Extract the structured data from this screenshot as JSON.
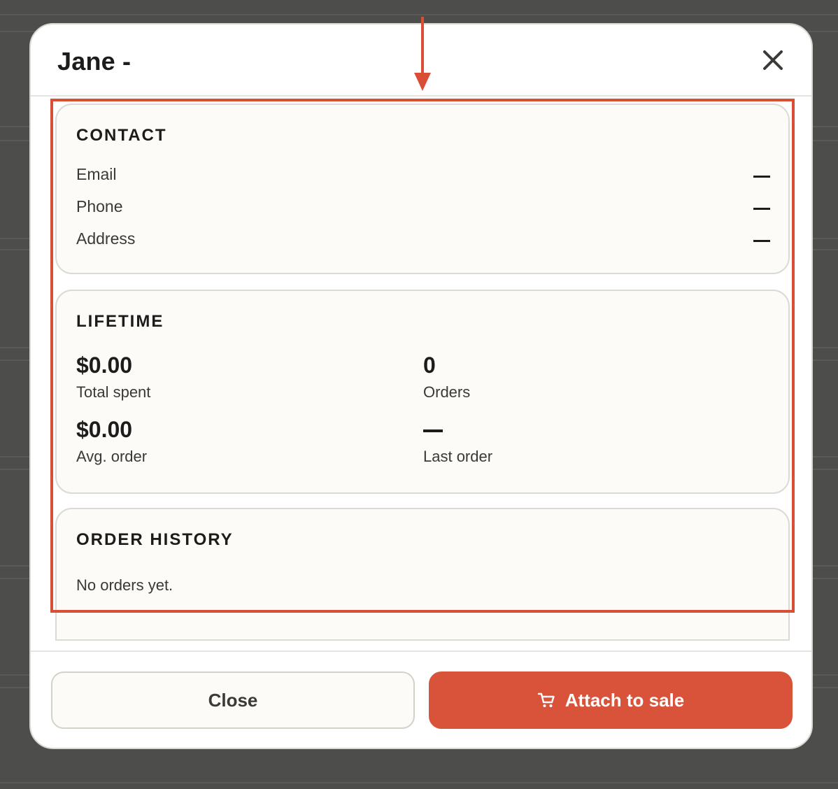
{
  "modal": {
    "title": "Jane -"
  },
  "contact": {
    "heading": "CONTACT",
    "rows": [
      {
        "label": "Email",
        "value": "—"
      },
      {
        "label": "Phone",
        "value": "—"
      },
      {
        "label": "Address",
        "value": "—"
      }
    ]
  },
  "lifetime": {
    "heading": "LIFETIME",
    "stats": [
      {
        "value": "$0.00",
        "label": "Total spent"
      },
      {
        "value": "0",
        "label": "Orders"
      },
      {
        "value": "$0.00",
        "label": "Avg. order"
      },
      {
        "value": "—",
        "label": "Last order"
      }
    ]
  },
  "order_history": {
    "heading": "ORDER HISTORY",
    "empty_text": "No orders yet."
  },
  "footer": {
    "close_label": "Close",
    "attach_label": "Attach to sale"
  },
  "icons": {
    "close": "close-icon",
    "cart": "cart-icon",
    "arrow": "arrow-down-icon"
  },
  "colors": {
    "accent": "#d9533a",
    "annotation": "#d94f36",
    "card_bg": "#fcfbf7",
    "backdrop": "#4d4d4b"
  }
}
